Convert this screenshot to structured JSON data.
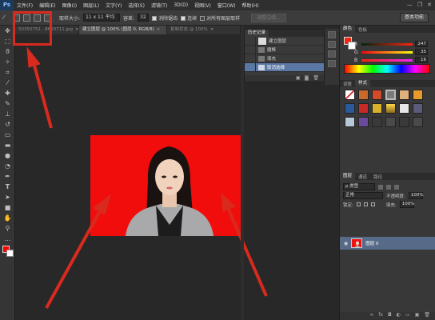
{
  "app": {
    "logo": "Ps"
  },
  "menu": [
    "文件(F)",
    "编辑(E)",
    "图像(I)",
    "图层(L)",
    "文字(Y)",
    "选择(S)",
    "滤镜(T)",
    "3D(D)",
    "视图(V)",
    "窗口(W)",
    "帮助(H)"
  ],
  "window_controls": {
    "minimize": "—",
    "restore": "❐",
    "close": "✕"
  },
  "options": {
    "sample_size_label": "取样大小:",
    "sample_size_value": "11 x 11 平均",
    "tolerance_label": "容差:",
    "tolerance_value": "32",
    "anti_alias_label": "消除锯齿",
    "contiguous_label": "连续",
    "sample_all_label": "对所有图层取样",
    "refine_edge_label": "调整边缘...",
    "workspace": "基本功能"
  },
  "tabs": [
    {
      "label": "50350751...8650711.jpg",
      "active": false
    },
    {
      "label": "建立图层 @ 100% (图层 0, RGB/8)",
      "active": true
    },
    {
      "label": "复制状态 @ 100%",
      "active": false
    }
  ],
  "history": {
    "tabs": [
      "历史记录",
      ""
    ],
    "items": [
      {
        "label": "建立图层",
        "selected": false
      },
      {
        "label": "魔棒",
        "selected": false
      },
      {
        "label": "填充",
        "selected": false
      },
      {
        "label": "取消选择",
        "selected": true
      }
    ]
  },
  "color_panel": {
    "tabs": [
      "颜色",
      "色板"
    ],
    "channels": [
      {
        "label": "R",
        "value": "247"
      },
      {
        "label": "G",
        "value": "35"
      },
      {
        "label": "B",
        "value": "16"
      }
    ],
    "foreground_color": "#f72310"
  },
  "adjust_panel": {
    "tabs": [
      "调整",
      "样式"
    ]
  },
  "layers_panel": {
    "tabs": [
      "图层",
      "通道",
      "路径"
    ],
    "kind_filter": "ρ 类型",
    "blend_mode": "正常",
    "opacity_label": "不透明度:",
    "opacity_value": "100%",
    "lock_label": "锁定:",
    "fill_label": "填充:",
    "fill_value": "100%",
    "layer_name": "图层 0"
  },
  "colors": {
    "highlight": "#d82a1f",
    "canvas_bg": "#f20d0d"
  }
}
